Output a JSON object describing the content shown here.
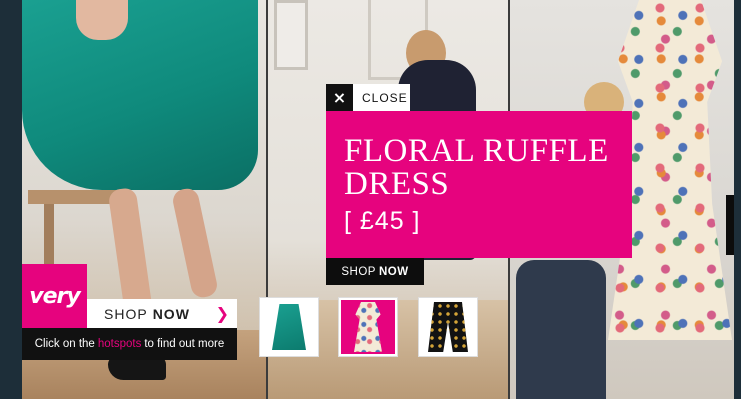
{
  "ad": {
    "close_label": "CLOSE",
    "close_icon": "×",
    "product_title": "FLORAL RUFFLE DRESS",
    "product_price": "[ £45 ]",
    "popup_shop": "SHOP",
    "popup_now": "NOW"
  },
  "brand": {
    "logo_text": "very",
    "shop": "SHOP",
    "now": "NOW",
    "arrow": "❯"
  },
  "hint": {
    "before": "Click on the",
    "highlight": "hotspots",
    "after": "to find out more"
  },
  "thumbnails": [
    {
      "name": "green pleated skirt"
    },
    {
      "name": "floral ruffle dress"
    },
    {
      "name": "black military jacket"
    }
  ],
  "colors": {
    "brand_pink": "#e6037e",
    "black": "#111111",
    "white": "#ffffff"
  }
}
